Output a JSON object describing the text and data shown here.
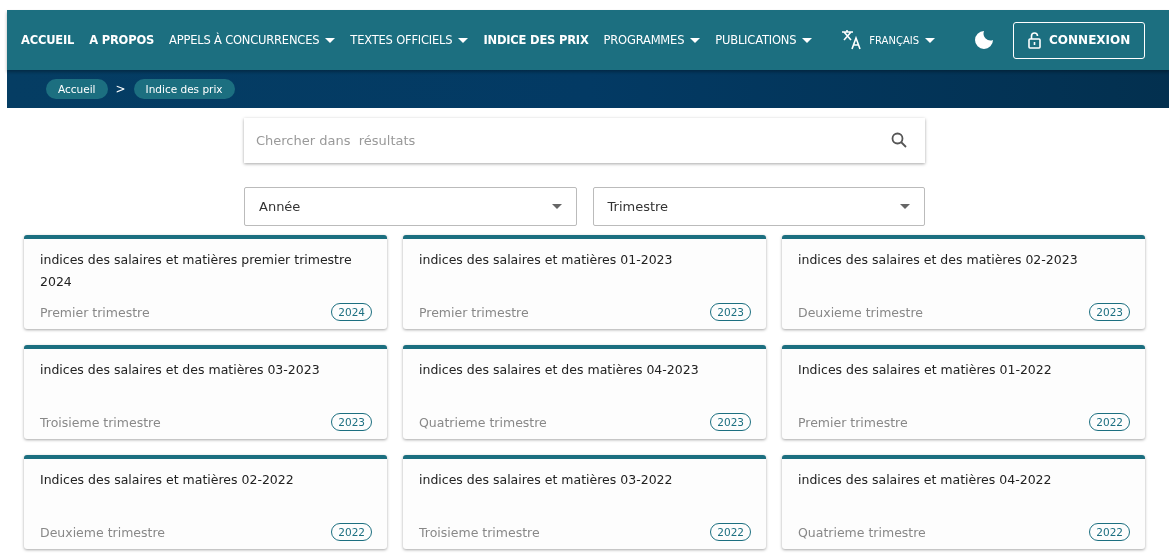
{
  "nav": {
    "items": [
      {
        "label": "ACCUEIL",
        "dropdown": false
      },
      {
        "label": "A PROPOS",
        "dropdown": false
      },
      {
        "label": "APPELS À CONCURRENCES",
        "dropdown": true
      },
      {
        "label": "TEXTES OFFICIELS",
        "dropdown": true
      },
      {
        "label": "INDICE DES PRIX",
        "dropdown": false
      },
      {
        "label": "PROGRAMMES",
        "dropdown": true
      },
      {
        "label": "PUBLICATIONS",
        "dropdown": true
      }
    ],
    "language": "FRANÇAIS",
    "login": "CONNEXION"
  },
  "breadcrumb": [
    "Accueil",
    "Indice des prix"
  ],
  "breadcrumb_separator": ">",
  "search": {
    "placeholder": "Chercher dans  résultats"
  },
  "filters": [
    {
      "label": "Année"
    },
    {
      "label": "Trimestre"
    }
  ],
  "cards": [
    {
      "title": "indices des salaires et matières premier trimestre 2024",
      "quarter": "Premier trimestre",
      "year": "2024"
    },
    {
      "title": "indices des salaires et matières 01-2023",
      "quarter": "Premier trimestre",
      "year": "2023"
    },
    {
      "title": "indices des salaires et des matières 02-2023",
      "quarter": "Deuxieme trimestre",
      "year": "2023"
    },
    {
      "title": "indices des salaires et des matières 03-2023",
      "quarter": "Troisieme trimestre",
      "year": "2023"
    },
    {
      "title": "indices des salaires et des matières 04-2023",
      "quarter": "Quatrieme trimestre",
      "year": "2023"
    },
    {
      "title": "Indices des salaires et matières 01-2022",
      "quarter": "Premier trimestre",
      "year": "2022"
    },
    {
      "title": "Indices des salaires et matières 02-2022",
      "quarter": "Deuxieme trimestre",
      "year": "2022"
    },
    {
      "title": "indices des salaires et matières 03-2022",
      "quarter": "Troisieme trimestre",
      "year": "2022"
    },
    {
      "title": "indices des salaires et matières 04-2022",
      "quarter": "Quatrieme trimestre",
      "year": "2022"
    }
  ]
}
